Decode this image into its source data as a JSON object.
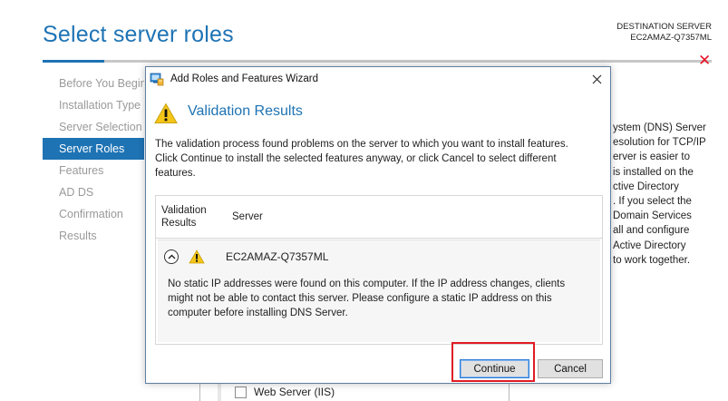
{
  "page": {
    "title": "Select server roles",
    "destination_label": "DESTINATION SERVER",
    "destination_server": "EC2AMAZ-Q7357ML"
  },
  "nav": {
    "items": [
      {
        "label": "Before You Begin"
      },
      {
        "label": "Installation Type"
      },
      {
        "label": "Server Selection"
      },
      {
        "label": "Server Roles"
      },
      {
        "label": "Features"
      },
      {
        "label": "AD DS"
      },
      {
        "label": "Confirmation"
      },
      {
        "label": "Results"
      }
    ],
    "active_index": 3
  },
  "background_description": {
    "lines": [
      "ystem (DNS) Server",
      "esolution for TCP/IP",
      "erver is easier to",
      "is installed on the",
      "ctive Directory",
      ". If you select the",
      "Domain Services",
      "all and configure",
      "Active Directory",
      "to work together."
    ]
  },
  "background_list": {
    "item_label": "Web Server (IIS)"
  },
  "dialog": {
    "title": "Add Roles and Features Wizard",
    "heading": "Validation Results",
    "message_lines": [
      "The validation process found problems on the server to which you want to install features.",
      "Click Continue to install the selected features anyway, or click Cancel to select different",
      "features."
    ],
    "table": {
      "col_validation_line1": "Validation",
      "col_validation_line2": "Results",
      "col_server": "Server",
      "row": {
        "server": "EC2AMAZ-Q7357ML",
        "message_lines": [
          "No static IP addresses were found on this computer. If the IP address changes, clients",
          "might not be able to contact this server. Please configure a static IP address on this",
          "computer before installing DNS Server."
        ]
      }
    },
    "buttons": {
      "continue": "Continue",
      "cancel": "Cancel"
    }
  },
  "colors": {
    "accent": "#1e73b4",
    "warning": "#f5c518",
    "highlight": "#e01b24",
    "close_red": "#e81123"
  }
}
